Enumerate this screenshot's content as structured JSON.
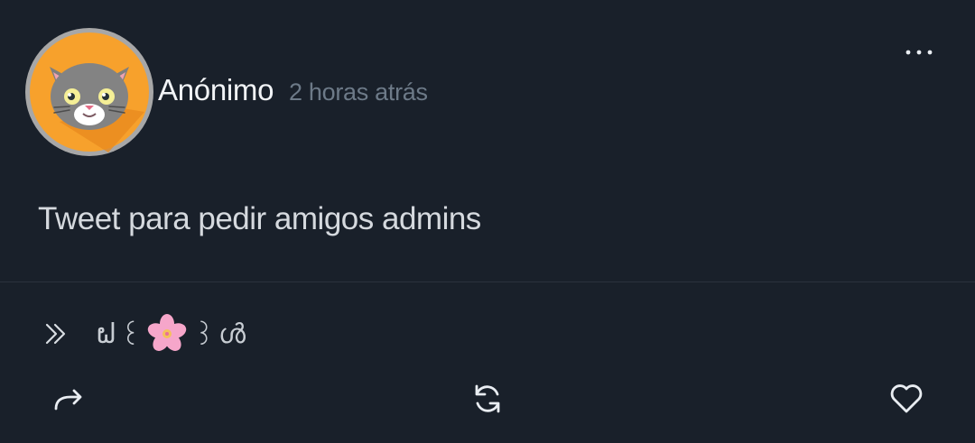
{
  "post": {
    "username": "Anónimo",
    "timestamp": "2 horas atrás",
    "text": "Tweet para pedir amigos admins"
  },
  "tag": {
    "left": "ຝ",
    "left2": "꒰",
    "right": "꒱",
    "right2": "ൾ"
  },
  "icons": {
    "avatar": "gray-cat-avatar-icon",
    "more": "more-options-icon",
    "tag_arrow": "double-chevron-right-icon",
    "flower": "cherry-blossom-icon",
    "share": "share-arrow-icon",
    "repost": "repost-icon",
    "like": "heart-icon"
  },
  "colors": {
    "background": "#19202a",
    "avatar_bg": "#f7a12c",
    "username": "#f1f3f6",
    "timestamp": "#6d7a88",
    "icon": "#e9edf2"
  }
}
